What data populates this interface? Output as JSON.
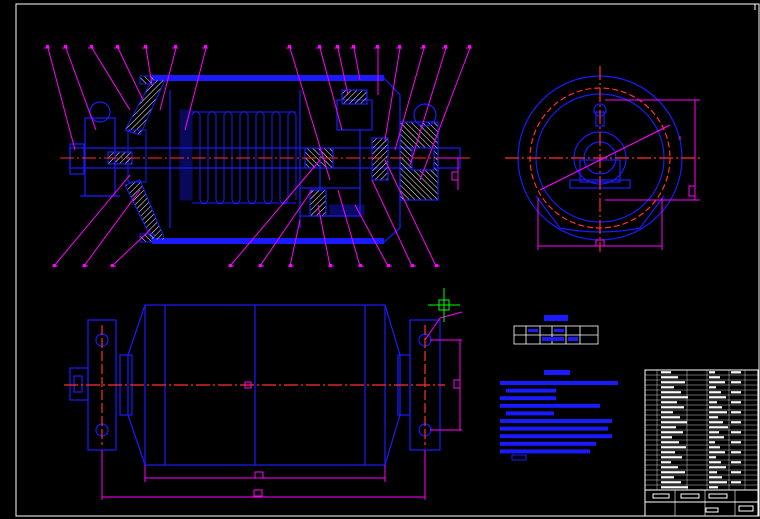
{
  "drawing": {
    "background": "#000000",
    "colors": {
      "frame": "#ffffff",
      "outline": "#1a1aff",
      "leader": "#ff00ff",
      "center": "#ff3030",
      "hatch": "#ffffff",
      "dim": "#ff00ff",
      "cursor": "#00ff00",
      "table_text": "#ffffff",
      "table_fill": "#1a1aff"
    },
    "views": [
      {
        "name": "section-view"
      },
      {
        "name": "end-view"
      },
      {
        "name": "top-view"
      }
    ],
    "balloons": {
      "top_count": 16,
      "bottom_count": 15
    },
    "text_block": {
      "lines": 10
    },
    "title_block": {
      "rows": 24,
      "columns": 6
    },
    "icons": [
      "crosshair-cursor-icon"
    ]
  }
}
